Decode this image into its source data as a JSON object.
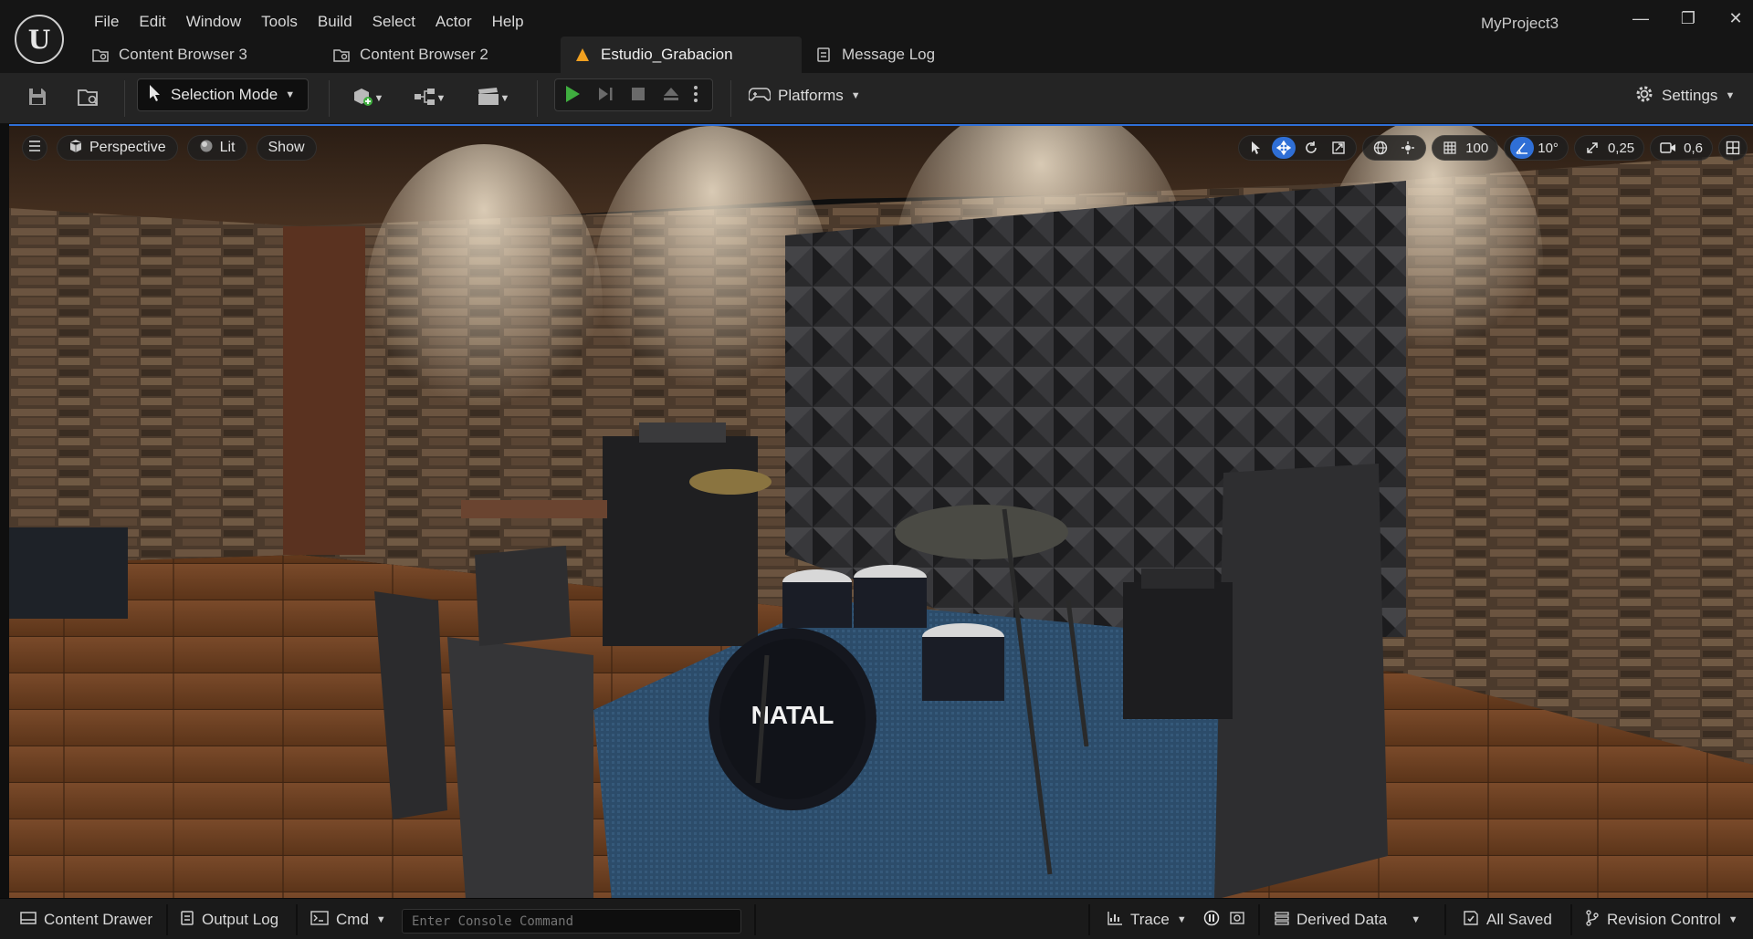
{
  "app": {
    "logo": "U",
    "project_name": "MyProject3"
  },
  "menu": [
    "File",
    "Edit",
    "Window",
    "Tools",
    "Build",
    "Select",
    "Actor",
    "Help"
  ],
  "window_controls": {
    "minimize": "—",
    "restore": "❐",
    "close": "✕"
  },
  "tabs": [
    {
      "label": "Content Browser 3",
      "icon": "content-browser-icon",
      "active": false
    },
    {
      "label": "Content Browser 2",
      "icon": "content-browser-icon",
      "active": false
    },
    {
      "label": "Estudio_Grabacion",
      "icon": "level-icon",
      "active": true
    },
    {
      "label": "Message Log",
      "icon": "message-log-icon",
      "active": false
    }
  ],
  "toolbar": {
    "selection_mode": "Selection Mode",
    "platforms": "Platforms",
    "settings": "Settings"
  },
  "viewport": {
    "perspective": "Perspective",
    "lit": "Lit",
    "show": "Show",
    "grid_snap": "100",
    "rotation_snap": "10°",
    "scale_snap": "0,25",
    "camera_speed": "0,6",
    "scene_text": "NATAL"
  },
  "statusbar": {
    "content_drawer": "Content Drawer",
    "output_log": "Output Log",
    "cmd": "Cmd",
    "console_placeholder": "Enter Console Command",
    "trace": "Trace",
    "derived_data": "Derived Data",
    "all_saved": "All Saved",
    "revision_control": "Revision Control"
  },
  "colors": {
    "accent": "#2f6fd6",
    "play": "#3fae3f",
    "level_tab_icon": "#f0a020"
  }
}
